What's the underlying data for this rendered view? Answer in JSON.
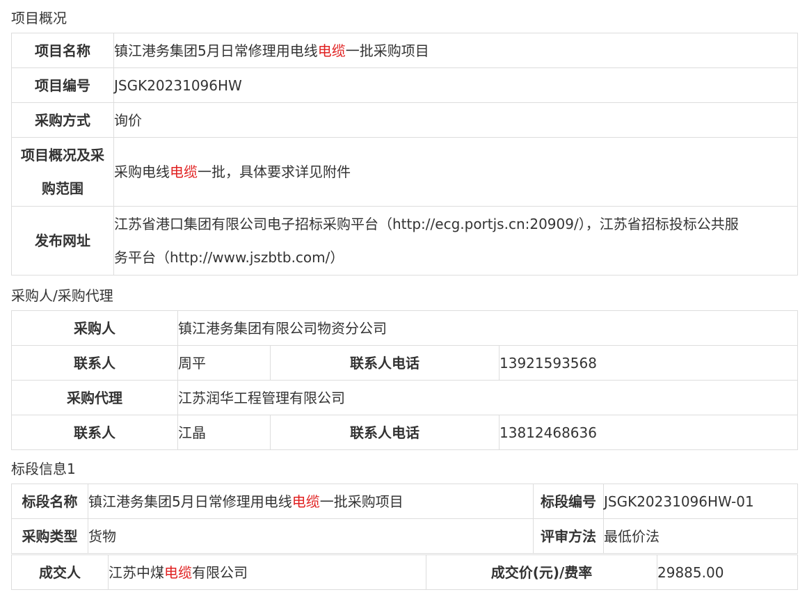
{
  "sections": {
    "overview": "项目概况",
    "purchaser": "采购人/采购代理",
    "lot": "标段信息1"
  },
  "overview": {
    "name_label": "项目名称",
    "name_pre": "镇江港务集团5月日常修理用电线",
    "name_hl": "电缆",
    "name_post": "一批采购项目",
    "code_label": "项目编号",
    "code": "JSGK20231096HW",
    "method_label": "采购方式",
    "method": "询价",
    "scope_label_1": "项目概况及采",
    "scope_label_2": "购范围",
    "scope_pre": "采购电线",
    "scope_hl": "电缆",
    "scope_post": "一批，具体要求详见附件",
    "url_label": "发布网址",
    "url_line1": "江苏省港口集团有限公司电子招标采购平台（http://ecg.portjs.cn:20909/），江苏省招标投标公共服",
    "url_line2": "务平台（http://www.jszbtb.com/）"
  },
  "purchaser": {
    "buyer_label": "采购人",
    "buyer": "镇江港务集团有限公司物资分公司",
    "contact_label": "联系人",
    "contact": "周平",
    "phone_label": "联系人电话",
    "phone": "13921593568",
    "agent_label": "采购代理",
    "agent": "江苏润华工程管理有限公司",
    "agent_contact_label": "联系人",
    "agent_contact": "江晶",
    "agent_phone_label": "联系人电话",
    "agent_phone": "13812468636"
  },
  "lot": {
    "name_label": "标段名称",
    "name_pre": "镇江港务集团5月日常修理用电线",
    "name_hl": "电缆",
    "name_post": "一批采购项目",
    "code_label": "标段编号",
    "code": "JSGK20231096HW-01",
    "type_label": "采购类型",
    "type": "货物",
    "eval_label": "评审方法",
    "eval": "最低价法",
    "winner_label": "成交人",
    "winner_pre": "江苏中煤",
    "winner_hl": "电缆",
    "winner_post": "有限公司",
    "price_label": "成交价(元)/费率",
    "price": "29885.00"
  },
  "colors": {
    "highlight": "#e02020",
    "border": "#dddddd"
  }
}
